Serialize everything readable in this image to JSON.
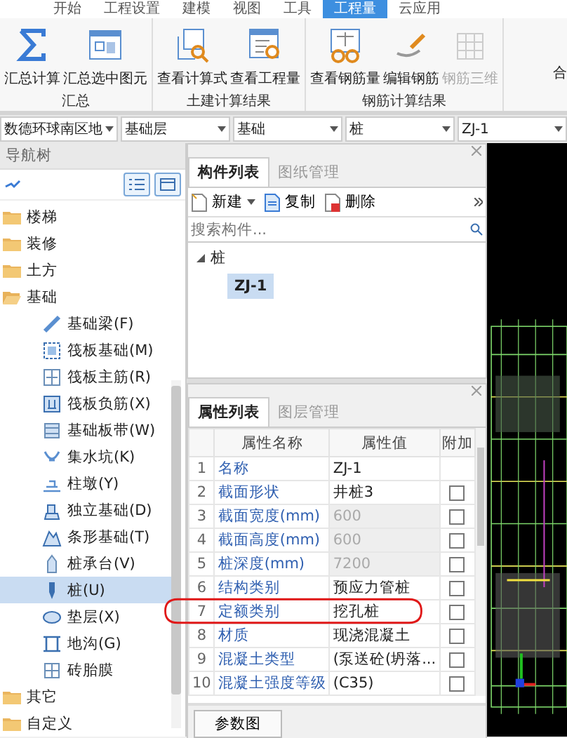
{
  "ribbon_tabs": [
    {
      "label": "开始",
      "selected": false
    },
    {
      "label": "工程设置",
      "selected": false
    },
    {
      "label": "建模",
      "selected": false
    },
    {
      "label": "视图",
      "selected": false
    },
    {
      "label": "工具",
      "selected": false
    },
    {
      "label": "工程量",
      "selected": true
    },
    {
      "label": "云应用",
      "selected": false
    }
  ],
  "ribbon_groups": [
    {
      "label": "汇总",
      "buttons": [
        {
          "label": "汇总计算",
          "disabled": false
        },
        {
          "label": "汇总选中图元",
          "disabled": false
        }
      ]
    },
    {
      "label": "土建计算结果",
      "buttons": [
        {
          "label": "查看计算式",
          "disabled": false
        },
        {
          "label": "查看工程量",
          "disabled": false
        }
      ]
    },
    {
      "label": "钢筋计算结果",
      "buttons": [
        {
          "label": "查看钢筋量",
          "disabled": false
        },
        {
          "label": "编辑钢筋",
          "disabled": false
        },
        {
          "label": "钢筋三维",
          "disabled": true
        }
      ]
    }
  ],
  "ribbon_overflow": "合",
  "selectors": [
    "数德环球南区地",
    "基础层",
    "基础",
    "桩",
    "ZJ-1"
  ],
  "nav_tree": {
    "title": "导航树",
    "items": [
      {
        "label": "楼梯",
        "expanded": false
      },
      {
        "label": "装修",
        "expanded": false
      },
      {
        "label": "土方",
        "expanded": false
      },
      {
        "label": "基础",
        "expanded": true,
        "children": [
          {
            "label": "基础梁(F)",
            "selected": false
          },
          {
            "label": "筏板基础(M)",
            "selected": false
          },
          {
            "label": "筏板主筋(R)",
            "selected": false
          },
          {
            "label": "筏板负筋(X)",
            "selected": false
          },
          {
            "label": "基础板带(W)",
            "selected": false
          },
          {
            "label": "集水坑(K)",
            "selected": false
          },
          {
            "label": "柱墩(Y)",
            "selected": false
          },
          {
            "label": "独立基础(D)",
            "selected": false
          },
          {
            "label": "条形基础(T)",
            "selected": false
          },
          {
            "label": "桩承台(V)",
            "selected": false
          },
          {
            "label": "桩(U)",
            "selected": true
          },
          {
            "label": "垫层(X)",
            "selected": false
          },
          {
            "label": "地沟(G)",
            "selected": false
          },
          {
            "label": "砖胎膜",
            "selected": false
          }
        ]
      },
      {
        "label": "其它",
        "expanded": false
      },
      {
        "label": "自定义",
        "expanded": false
      }
    ]
  },
  "component_panel": {
    "tabs": [
      {
        "label": "构件列表",
        "selected": true
      },
      {
        "label": "图纸管理",
        "selected": false
      }
    ],
    "toolbar": [
      "新建",
      "复制",
      "删除"
    ],
    "search": {
      "placeholder": "搜索构件..."
    },
    "tree": {
      "label": "桩",
      "expanded": true,
      "children": [
        {
          "label": "ZJ-1",
          "selected": true
        }
      ]
    }
  },
  "property_panel": {
    "tabs": [
      {
        "label": "属性列表",
        "selected": true
      },
      {
        "label": "图层管理",
        "selected": false
      }
    ],
    "columns": [
      "属性名称",
      "属性值",
      "附加"
    ],
    "rows": [
      {
        "index": "1",
        "name": "名称",
        "value": "ZJ-1",
        "kind": "fixed",
        "disabled": false
      },
      {
        "index": "2",
        "name": "截面形状",
        "value": "井桩3",
        "kind": "checkable",
        "checked": false,
        "disabled": false
      },
      {
        "index": "3",
        "name": "截面宽度(mm)",
        "value": "600",
        "kind": "checkable",
        "checked": false,
        "disabled": true
      },
      {
        "index": "4",
        "name": "截面高度(mm)",
        "value": "600",
        "kind": "checkable",
        "checked": false,
        "disabled": true
      },
      {
        "index": "5",
        "name": "桩深度(mm)",
        "value": "7200",
        "kind": "checkable",
        "checked": false,
        "disabled": true
      },
      {
        "index": "6",
        "name": "结构类别",
        "value": "预应力管桩",
        "kind": "checkable",
        "checked": false,
        "disabled": false
      },
      {
        "index": "7",
        "name": "定额类别",
        "value": "挖孔桩",
        "kind": "checkable",
        "checked": false,
        "disabled": false,
        "circled": true
      },
      {
        "index": "8",
        "name": "材质",
        "value": "现浇混凝土",
        "kind": "checkable",
        "checked": false,
        "disabled": false
      },
      {
        "index": "9",
        "name": "混凝土类型",
        "value": "(泵送砼(坍落...",
        "kind": "checkable",
        "checked": false,
        "disabled": false
      },
      {
        "index": "10",
        "name": "混凝土强度等级",
        "value": "(C35)",
        "kind": "checkable",
        "checked": false,
        "disabled": false
      }
    ],
    "button": "参数图"
  }
}
